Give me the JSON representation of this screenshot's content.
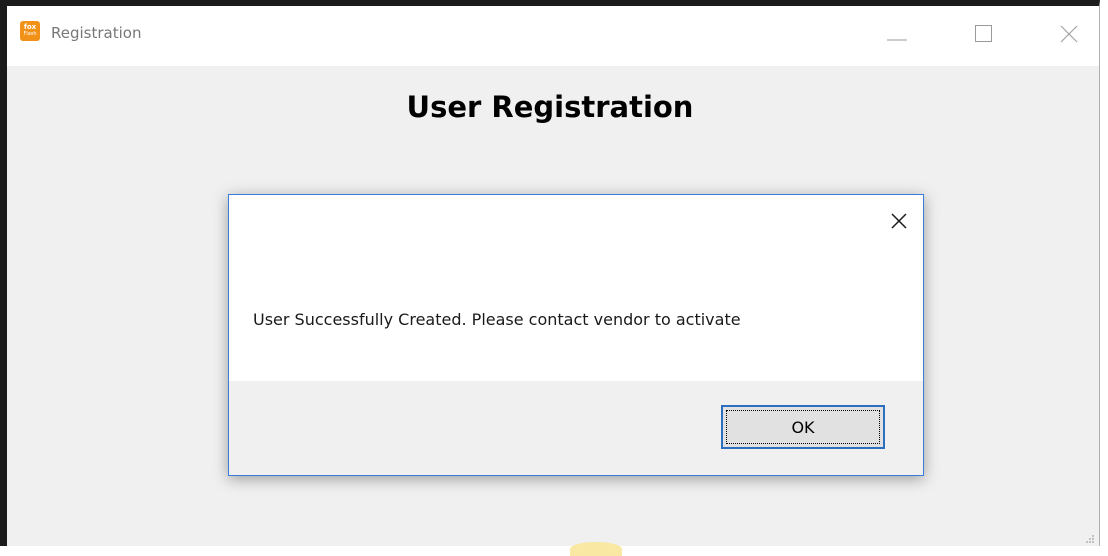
{
  "window": {
    "title": "Registration",
    "icon": {
      "line1": "fox",
      "line2": "Flash",
      "name": "app-logo-icon",
      "color": "#f29118"
    },
    "controls": [
      "minimize-icon",
      "maximize-icon",
      "close-icon"
    ]
  },
  "main": {
    "heading": "User Registration"
  },
  "dialog": {
    "message": "User Successfully Created. Please contact vendor to activate",
    "ok_label": "OK",
    "close_icon": "close-icon",
    "border_color": "#3a7bd5"
  }
}
